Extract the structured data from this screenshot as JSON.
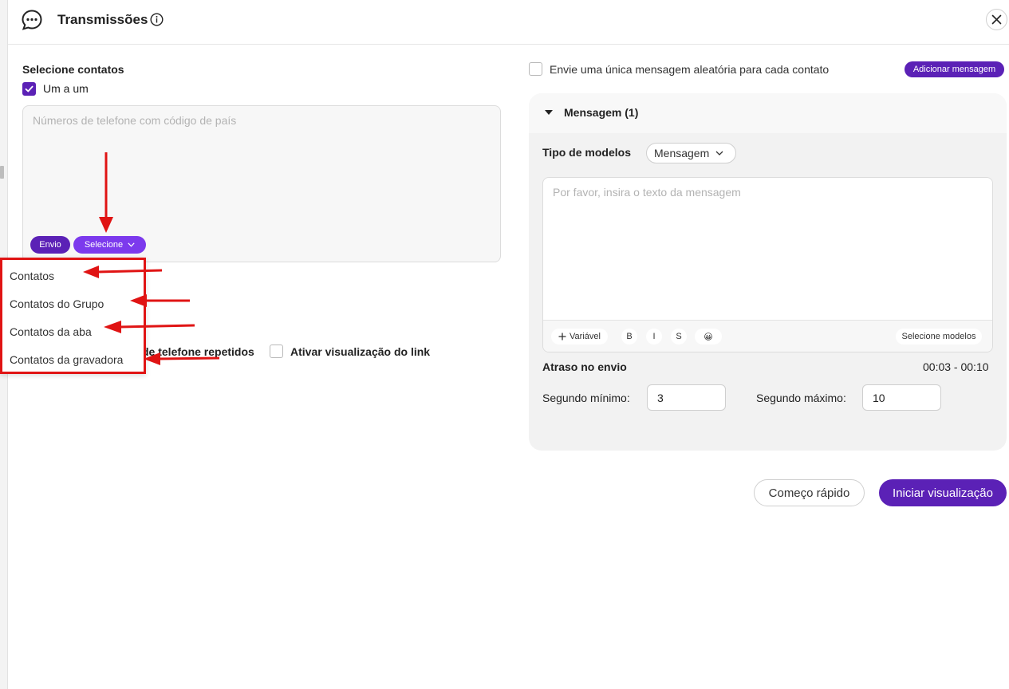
{
  "header": {
    "title": "Transmissões",
    "icons": [
      "chat-bubble-icon",
      "info-icon",
      "close-icon"
    ]
  },
  "contacts": {
    "section_label": "Selecione contatos",
    "one_by_one_label": "Um a um",
    "one_by_one_checked": true,
    "phones_placeholder": "Números de telefone com código de país",
    "envio_label": "Envio",
    "select_label": "Selecione"
  },
  "dropdown": {
    "items": [
      "Contatos",
      "Contatos do Grupo",
      "Contatos da aba",
      "Contatos da gravadora"
    ]
  },
  "options": {
    "dedupe_label_partial": "de telefone repetidos",
    "link_preview_label": "Ativar visualização do link",
    "link_preview_checked": false
  },
  "message": {
    "random_label": "Envie uma única mensagem aleatória para cada contato",
    "random_checked": false,
    "add_message_label": "Adicionar mensagem",
    "panel_title": "Mensagem (1)",
    "template_type_label": "Tipo de modelos",
    "template_type_value": "Mensagem",
    "text_placeholder": "Por favor, insira o texto da mensagem",
    "toolbar": {
      "variable_label": "Variável",
      "bold_label": "B",
      "italic_label": "I",
      "strike_label": "S",
      "emoji_label": "😀",
      "select_templates_label": "Selecione modelos"
    }
  },
  "delay": {
    "label": "Atraso no envio",
    "range": "00:03 - 00:10",
    "min_label": "Segundo mínimo:",
    "min_value": "3",
    "max_label": "Segundo máximo:",
    "max_value": "10"
  },
  "actions": {
    "quick_start_label": "Começo rápido",
    "start_preview_label": "Iniciar visualização"
  },
  "colors": {
    "accent": "#5b21b6",
    "accent_light": "#7c3aed",
    "annotation": "#e01414"
  }
}
